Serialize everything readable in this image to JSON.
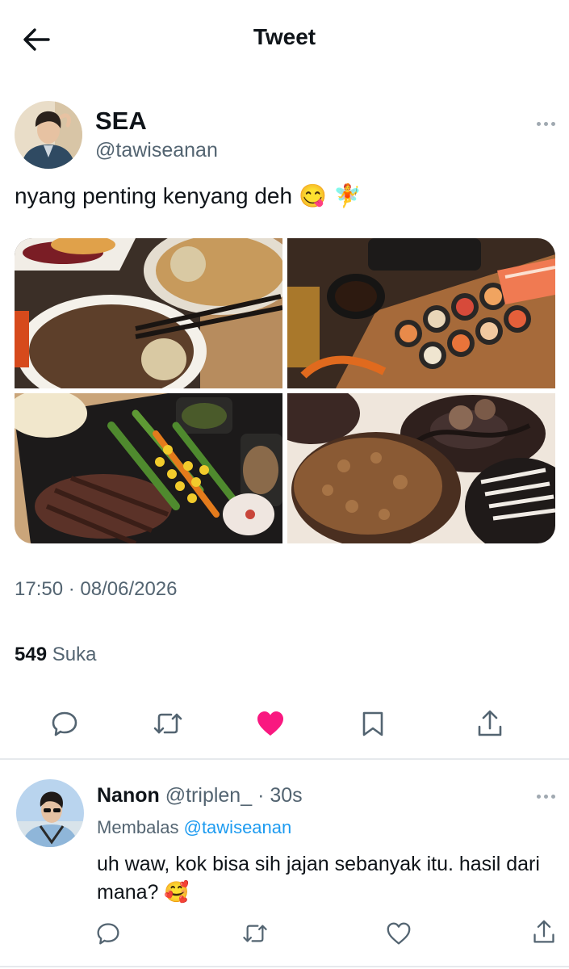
{
  "header": {
    "title": "Tweet",
    "back_icon": "arrow-left-icon"
  },
  "tweet": {
    "author_name": "SEA",
    "author_handle": "@tawiseanan",
    "text": "nyang penting kenyang deh",
    "emojis": [
      "😋",
      "🧚"
    ],
    "media": [
      "udon-beef-bowl-photo",
      "sushi-platter-photo",
      "steak-vegetables-photo",
      "chocolate-donuts-photo"
    ],
    "timestamp": "17:50 · 08/06/2026",
    "likes_count": "549",
    "likes_label": "Suka",
    "liked": true,
    "like_color": "#f91880"
  },
  "reply": {
    "author_name": "Nanon",
    "author_handle": "@triplen_",
    "time": "· 30s",
    "replying_prefix": "Membalas",
    "replying_to": "@tawiseanan",
    "text": "uh waw, kok bisa sih jajan sebanyak itu. hasil dari mana?",
    "emoji": "🥰"
  },
  "colors": {
    "secondary_text": "#536471",
    "link": "#1d9bf0"
  }
}
